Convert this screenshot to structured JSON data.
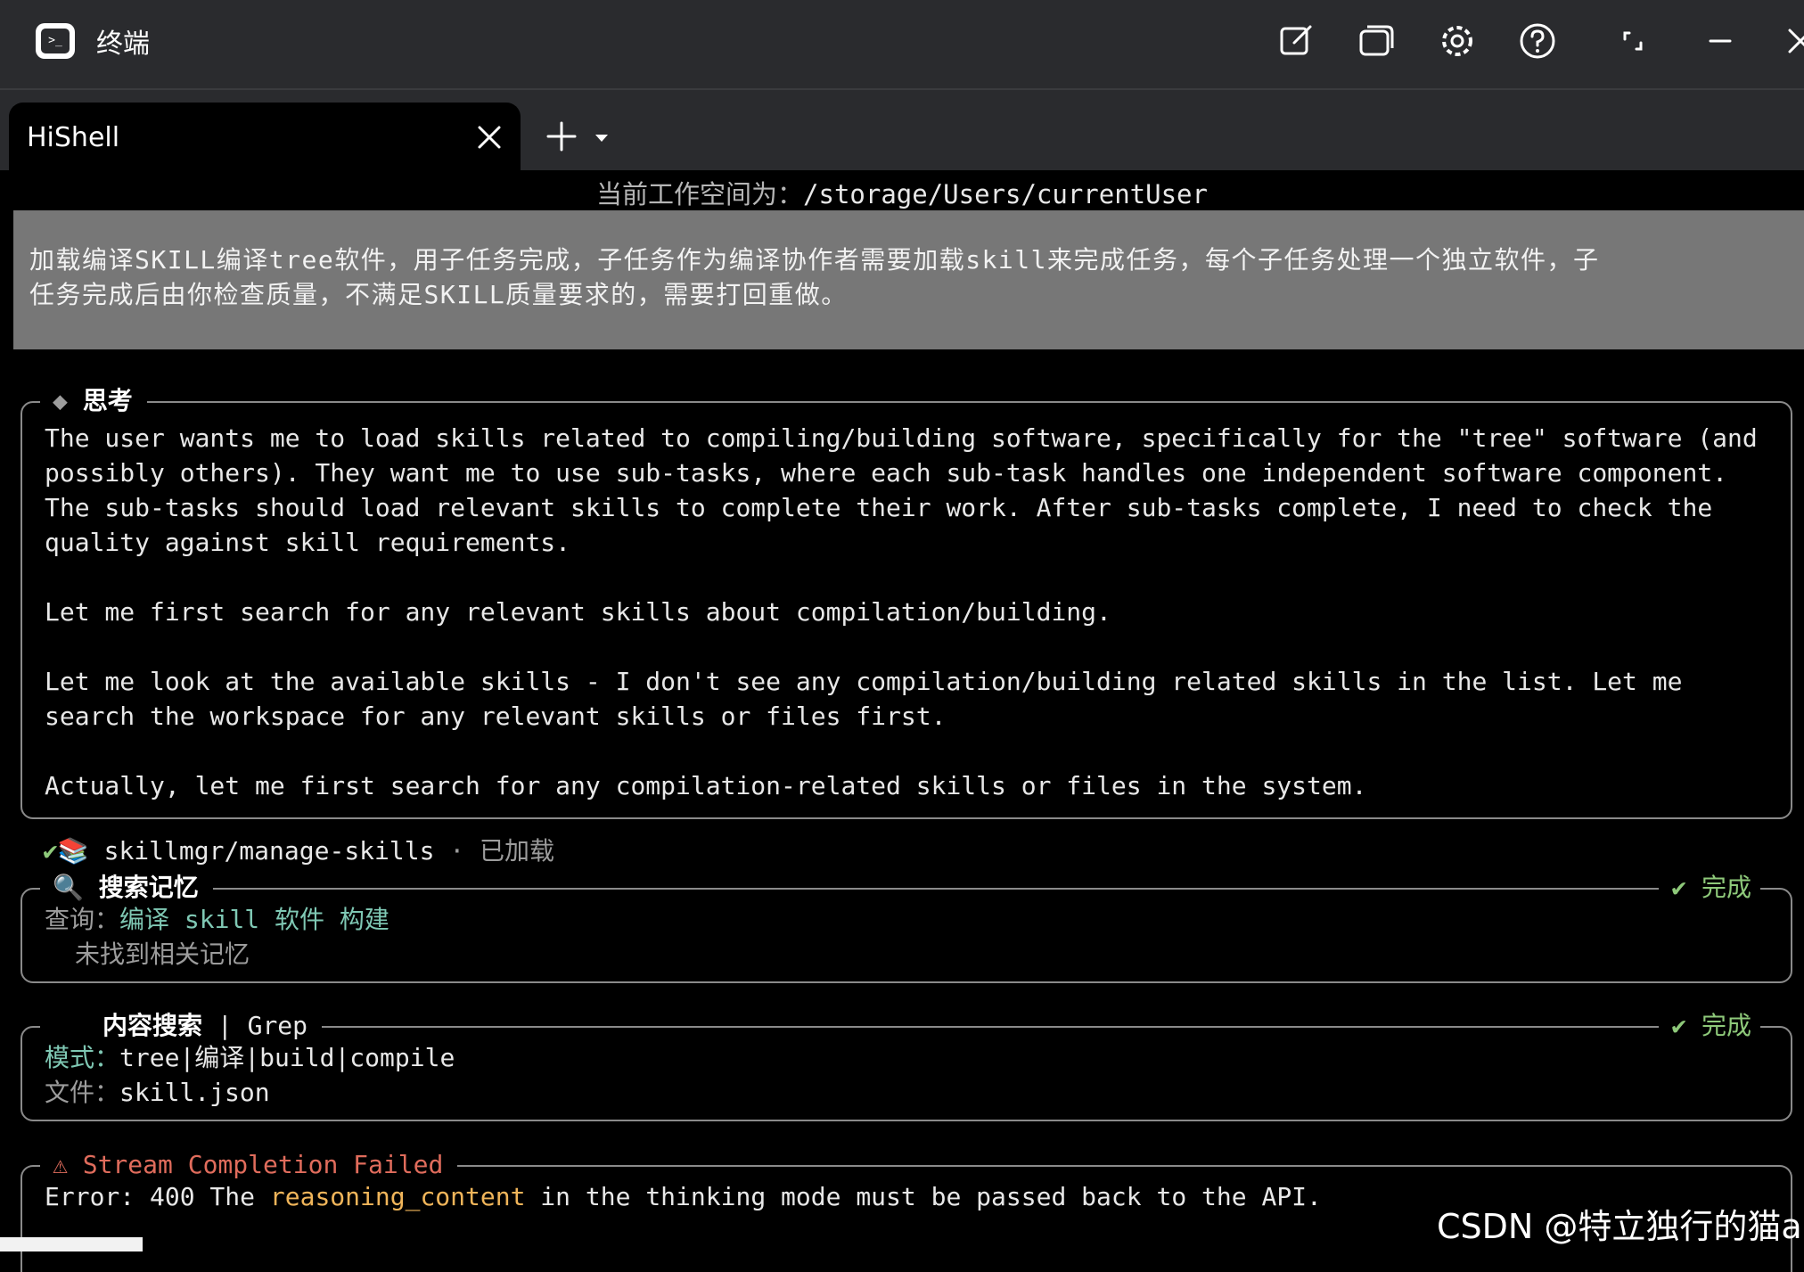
{
  "titlebar": {
    "app_title": "终端",
    "icons": [
      "terminal-app-icon",
      "edit-icon",
      "windows-icon",
      "gear-icon",
      "help-icon",
      "fullscreen-icon",
      "minimize-icon",
      "close-icon"
    ],
    "app_icon_glyph": ">_"
  },
  "tabs": [
    {
      "label": "HiShell",
      "active": true
    }
  ],
  "workspace": {
    "label": "当前工作空间为：",
    "path": "/storage/Users/currentUser"
  },
  "prompt": {
    "lines": [
      "加载编译SKILL编译tree软件，用子任务完成，子任务作为编译协作者需要加载skill来完成任务，每个子任务处理一个独立软件，子",
      "任务完成后由你检查质量，不满足SKILL质量要求的，需要打回重做。"
    ]
  },
  "thinking": {
    "title": "思考",
    "marker": "◆",
    "lines": [
      "The user wants me to load skills related to compiling/building software, specifically for the \"tree\" software (and",
      "possibly others). They want me to use sub-tasks, where each sub-task handles one independent software component.",
      "The sub-tasks should load relevant skills to complete their work. After sub-tasks complete, I need to check the",
      "quality against skill requirements.",
      "",
      "Let me first search for any relevant skills about compilation/building.",
      "",
      "Let me look at the available skills - I don't see any compilation/building related skills in the list. Let me",
      "search the workspace for any relevant skills or files first.",
      "",
      "Actually, let me first search for any compilation-related skills or files in the system."
    ]
  },
  "skill_loaded": {
    "check": "✔",
    "name": "skillmgr/manage-skills",
    "separator": "·",
    "status": "已加载"
  },
  "memory_search": {
    "title": "搜索记忆",
    "status": "完成",
    "query_label": "查询：",
    "query_value": "编译 skill 软件 构建",
    "result": "未找到相关记忆"
  },
  "content_search": {
    "title": "内容搜索",
    "tool": "Grep",
    "separator": "|",
    "status": "完成",
    "pattern_label": "模式：",
    "pattern_value": "tree|编译|build|compile",
    "file_label": "文件：",
    "file_value": "skill.json"
  },
  "error": {
    "title": "Stream Completion Failed",
    "prefix": "Error: 400 The ",
    "highlight": "reasoning_content",
    "suffix": " in the thinking mode must be passed back to the API."
  },
  "watermark": "CSDN @特立独行的猫a",
  "colors": {
    "titlebar_bg": "#2a2b2e",
    "prompt_bg": "#777777",
    "success": "#8ec97a",
    "query": "#7fc8b4",
    "error": "#e06c5c",
    "highlight": "#f0b55a"
  }
}
